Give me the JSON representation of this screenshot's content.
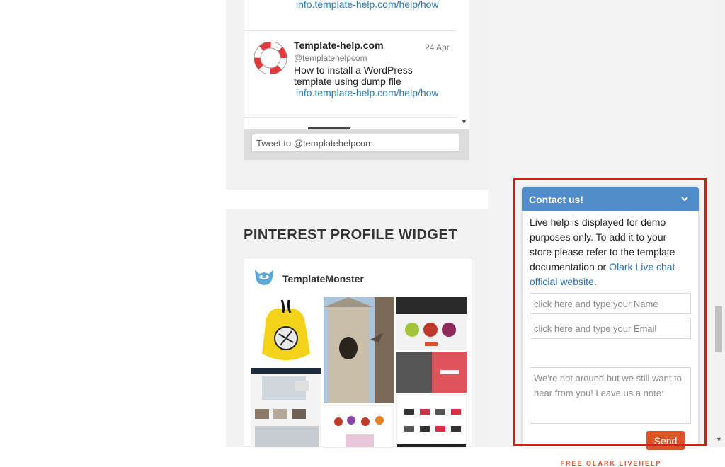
{
  "twitter_widget": {
    "prev_tweet_link": "info.template-help.com/help/how",
    "tweet": {
      "name": "Template-help.com",
      "handle": "@templatehelpcom",
      "date": "24 Apr",
      "text": "How to install a WordPress template using dump file",
      "link": "info.template-help.com/help/how"
    },
    "compose_placeholder": "Tweet to @templatehelpcom",
    "scroll_arrow": "▼"
  },
  "pinterest_widget": {
    "title": "PINTEREST PROFILE WIDGET",
    "profile_name": "TemplateMonster"
  },
  "chat": {
    "header_title": "Contact us!",
    "intro_text": "Live help is displayed for demo purposes only. To add it to your store please refer to the template documentation or ",
    "link_text": "Olark Live chat official website",
    "link_suffix": ".",
    "name_placeholder": "click here and type your Name",
    "email_placeholder": "click here and type your Email",
    "note_placeholder": "We're not around but we still want to hear from you! Leave us a note:",
    "send_label": "Send",
    "footer_text": "FREE OLARK LIVEHELP",
    "accent_color": "#4f8cc9",
    "send_color": "#d9532b"
  },
  "page_scrollbar": {
    "arrow": "▼"
  },
  "highlight_color": "#e0161b"
}
